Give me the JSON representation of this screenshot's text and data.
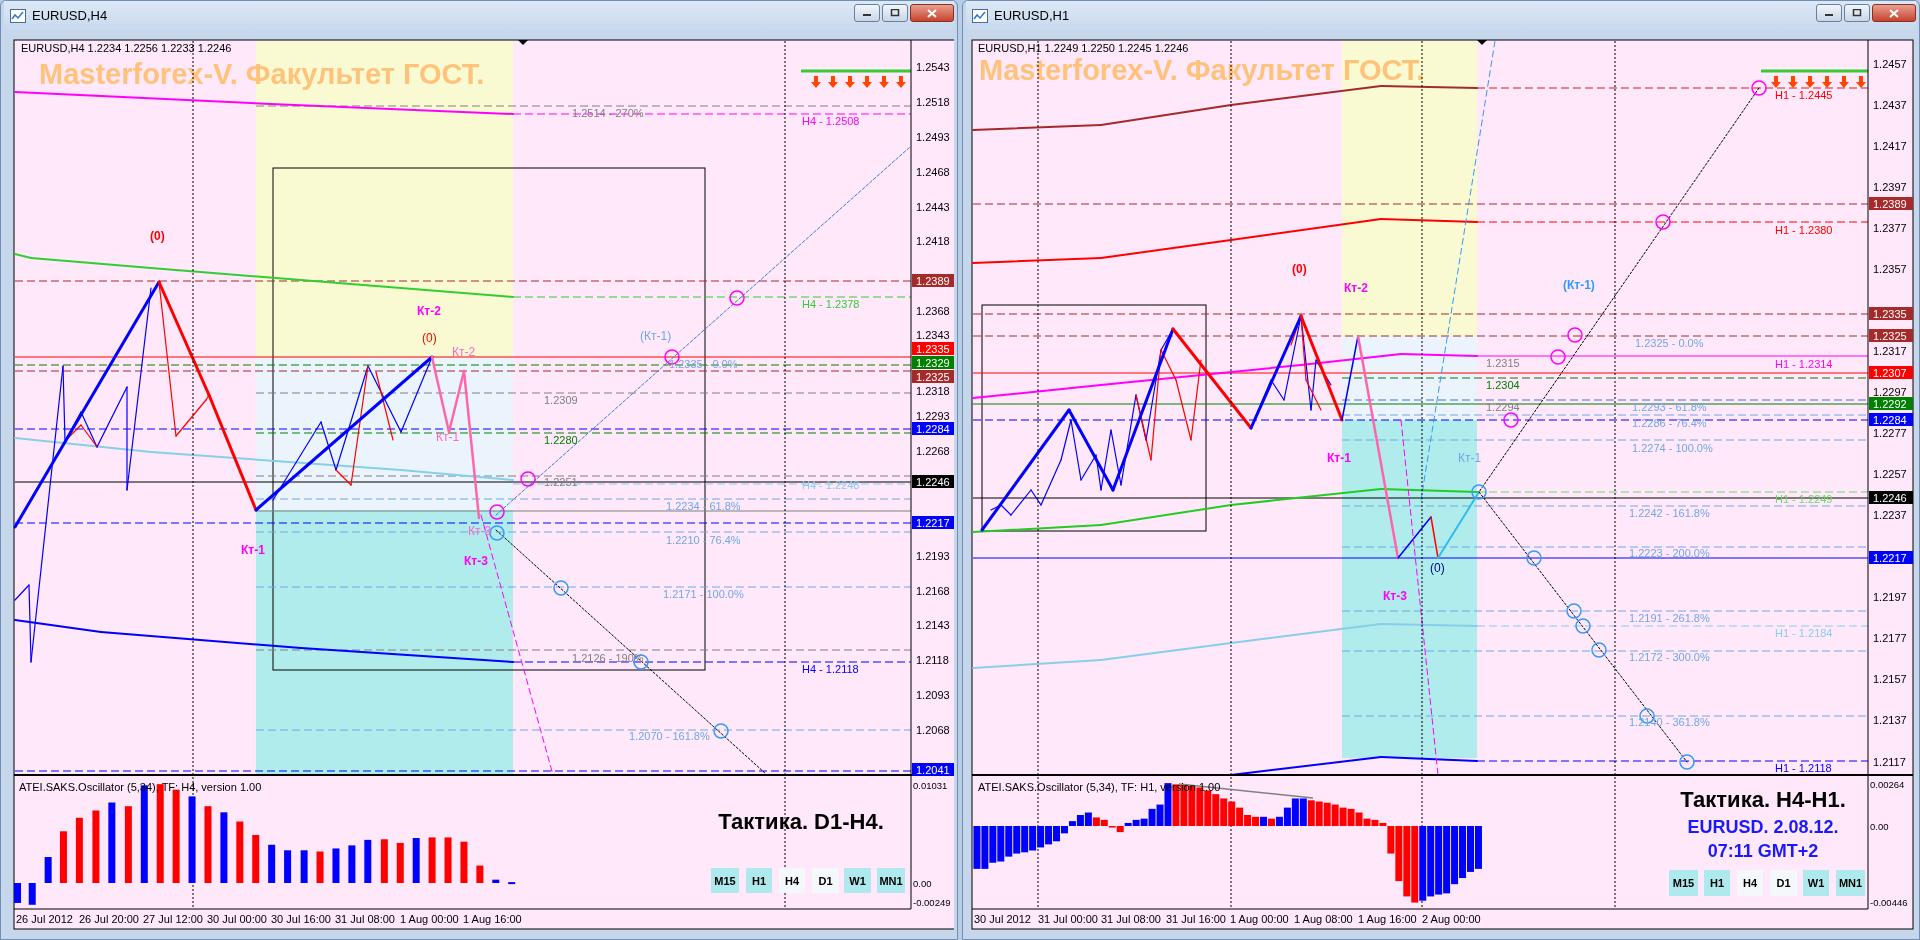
{
  "windows": [
    {
      "title": "EURUSD,H4",
      "chart": {
        "header": "EURUSD,H4 1.2234 1.2256 1.2233 1.2246",
        "watermark": "Masterforex-V. Факультет ГОСТ.",
        "price_ticks": [
          "1.2543",
          "1.2518",
          "1.2493",
          "1.2468",
          "1.2443",
          "1.2418",
          "1.2368",
          "1.2343",
          "1.2318",
          "1.2293",
          "1.2268",
          "1.2193",
          "1.2168",
          "1.2143",
          "1.2118",
          "1.2093",
          "1.2068"
        ],
        "price_tags": [
          {
            "text": "1.2389",
            "color": "#a52a2a"
          },
          {
            "text": "1.2335",
            "color": "#ff0000"
          },
          {
            "text": "1.2329",
            "color": "#008000"
          },
          {
            "text": "1.2325",
            "color": "#a52a2a"
          },
          {
            "text": "1.2284",
            "color": "#0000ff"
          },
          {
            "text": "1.2246",
            "color": "#000000"
          },
          {
            "text": "1.2217",
            "color": "#0000ff"
          },
          {
            "text": "1.2041",
            "color": "#0000ff"
          }
        ],
        "level_labels": [
          {
            "text": "1.2514 - 270%",
            "color": "#808080"
          },
          {
            "text": "H4 - 1.2508",
            "color": "#ff00ff"
          },
          {
            "text": "H4 - 1.2378",
            "color": "#32cd32"
          },
          {
            "text": "1.2335 - 0.0%",
            "color": "#6fa8e8"
          },
          {
            "text": "1.2309",
            "color": "#808080"
          },
          {
            "text": "1.2280",
            "color": "#008000"
          },
          {
            "text": "1.2251",
            "color": "#808080"
          },
          {
            "text": "H4 - 1.2248",
            "color": "#87ceeb"
          },
          {
            "text": "1.2234 - 61.8%",
            "color": "#6fa8e8"
          },
          {
            "text": "1.2210 - 76.4%",
            "color": "#6fa8e8"
          },
          {
            "text": "1.2171 - 100.0%",
            "color": "#6fa8e8"
          },
          {
            "text": "1.2126 - 190%",
            "color": "#808080"
          },
          {
            "text": "H4 - 1.2118",
            "color": "#0000ff"
          },
          {
            "text": "1.2070 - 161.8%",
            "color": "#6fa8e8"
          }
        ],
        "wave_labels": [
          {
            "text": "(0)",
            "color": "#ff0000",
            "bold": true
          },
          {
            "text": "Кт-2",
            "color": "#ff00ff",
            "bold": true
          },
          {
            "text": "(0)",
            "color": "#ff0000",
            "bold": false
          },
          {
            "text": "Кт-2",
            "color": "#ff66cc",
            "bold": false
          },
          {
            "text": "Кт-1",
            "color": "#ff66cc",
            "bold": false
          },
          {
            "text": "Кт-1",
            "color": "#ff00ff",
            "bold": true
          },
          {
            "text": "Кт-3",
            "color": "#ff66cc",
            "bold": false
          },
          {
            "text": "Кт-3",
            "color": "#ff00ff",
            "bold": true
          },
          {
            "text": "(Кт-1)",
            "color": "#6fa8e8",
            "bold": false
          }
        ],
        "oscillator": {
          "title": "ATEI.SAKS.Oscillator (5,34), TF: H4, version 1.00",
          "ticks": [
            "0.01031",
            "0.00",
            "-0.00249"
          ]
        },
        "info_lines": [
          {
            "text": "Тактика. D1-H4.",
            "color": "#000000"
          }
        ],
        "timeframes": [
          {
            "label": "M15",
            "selected": false
          },
          {
            "label": "H1",
            "selected": false
          },
          {
            "label": "H4",
            "selected": true
          },
          {
            "label": "D1",
            "selected": true
          },
          {
            "label": "W1",
            "selected": false
          },
          {
            "label": "MN1",
            "selected": false
          }
        ],
        "time_labels": [
          "26 Jul 2012",
          "26 Jul 20:00",
          "27 Jul 12:00",
          "30 Jul 00:00",
          "30 Jul 16:00",
          "31 Jul 08:00",
          "1 Aug 00:00",
          "1 Aug 16:00"
        ]
      }
    },
    {
      "title": "EURUSD,H1",
      "chart": {
        "header": "EURUSD,H1 1.2249 1.2250 1.2245 1.2246",
        "watermark": "Masterforex-V. Факультет ГОСТ.",
        "price_ticks": [
          "1.2457",
          "1.2437",
          "1.2417",
          "1.2397",
          "1.2377",
          "1.2357",
          "1.2317",
          "1.2297",
          "1.2277",
          "1.2257",
          "1.2237",
          "1.2197",
          "1.2177",
          "1.2157",
          "1.2137",
          "1.2117"
        ],
        "price_tags": [
          {
            "text": "1.2389",
            "color": "#a52a2a"
          },
          {
            "text": "1.2335",
            "color": "#a52a2a"
          },
          {
            "text": "1.2325",
            "color": "#a52a2a"
          },
          {
            "text": "1.2307",
            "color": "#ff0000"
          },
          {
            "text": "1.2292",
            "color": "#008000"
          },
          {
            "text": "1.2284",
            "color": "#0000ff"
          },
          {
            "text": "1.2246",
            "color": "#000000"
          },
          {
            "text": "1.2217",
            "color": "#0000ff"
          }
        ],
        "level_labels": [
          {
            "text": "H1 - 1.2445",
            "color": "#ff0000"
          },
          {
            "text": "H1 - 1.2380",
            "color": "#ff0000"
          },
          {
            "text": "1.2325 - 0.0%",
            "color": "#6fa8e8"
          },
          {
            "text": "1.2315",
            "color": "#808080"
          },
          {
            "text": "H1 - 1.2314",
            "color": "#ff00ff"
          },
          {
            "text": "1.2304",
            "color": "#008000"
          },
          {
            "text": "1.2294",
            "color": "#808080"
          },
          {
            "text": "1.2293 - 61.8%",
            "color": "#6fa8e8"
          },
          {
            "text": "1.2286 - 76.4%",
            "color": "#6fa8e8"
          },
          {
            "text": "1.2274 - 100.0%",
            "color": "#6fa8e8"
          },
          {
            "text": "H1 - 1.2249",
            "color": "#66dd66"
          },
          {
            "text": "1.2242 - 161.8%",
            "color": "#6fa8e8"
          },
          {
            "text": "1.2223 - 200.0%",
            "color": "#6fa8e8"
          },
          {
            "text": "1.2191 - 261.8%",
            "color": "#6fa8e8"
          },
          {
            "text": "H1 - 1.2184",
            "color": "#87ceeb"
          },
          {
            "text": "1.2172 - 300.0%",
            "color": "#6fa8e8"
          },
          {
            "text": "1.2140 - 361.8%",
            "color": "#6fa8e8"
          },
          {
            "text": "H1 - 1.2118",
            "color": "#0000ff"
          }
        ],
        "wave_labels": [
          {
            "text": "(0)",
            "color": "#ff0000",
            "bold": true
          },
          {
            "text": "Кт-2",
            "color": "#ff00ff",
            "bold": true
          },
          {
            "text": "(Кт-1)",
            "color": "#3399ff",
            "bold": true
          },
          {
            "text": "Кт-1",
            "color": "#ff00ff",
            "bold": true
          },
          {
            "text": "Кт-1",
            "color": "#6fa8e8",
            "bold": false
          },
          {
            "text": "(0)",
            "color": "#000080",
            "bold": false
          },
          {
            "text": "Кт-3",
            "color": "#ff00ff",
            "bold": true
          }
        ],
        "oscillator": {
          "title": "ATEI.SAKS.Oscillator (5,34), TF: H1, version 1.00",
          "ticks": [
            "0.00264",
            "0.00",
            "-0.00446"
          ]
        },
        "info_lines": [
          {
            "text": "Тактика. H4-H1.",
            "color": "#000000"
          },
          {
            "text": "EURUSD. 2.08.12.",
            "color": "#1a1aff"
          },
          {
            "text": "07:11 GMT+2",
            "color": "#1a1aff"
          }
        ],
        "timeframes": [
          {
            "label": "M15",
            "selected": false
          },
          {
            "label": "H1",
            "selected": false
          },
          {
            "label": "H4",
            "selected": true
          },
          {
            "label": "D1",
            "selected": true
          },
          {
            "label": "W1",
            "selected": false
          },
          {
            "label": "MN1",
            "selected": false
          }
        ],
        "time_labels": [
          "30 Jul 2012",
          "31 Jul 00:00",
          "31 Jul 08:00",
          "31 Jul 16:00",
          "1 Aug 00:00",
          "1 Aug 08:00",
          "1 Aug 16:00",
          "2 Aug 00:00"
        ]
      }
    }
  ]
}
